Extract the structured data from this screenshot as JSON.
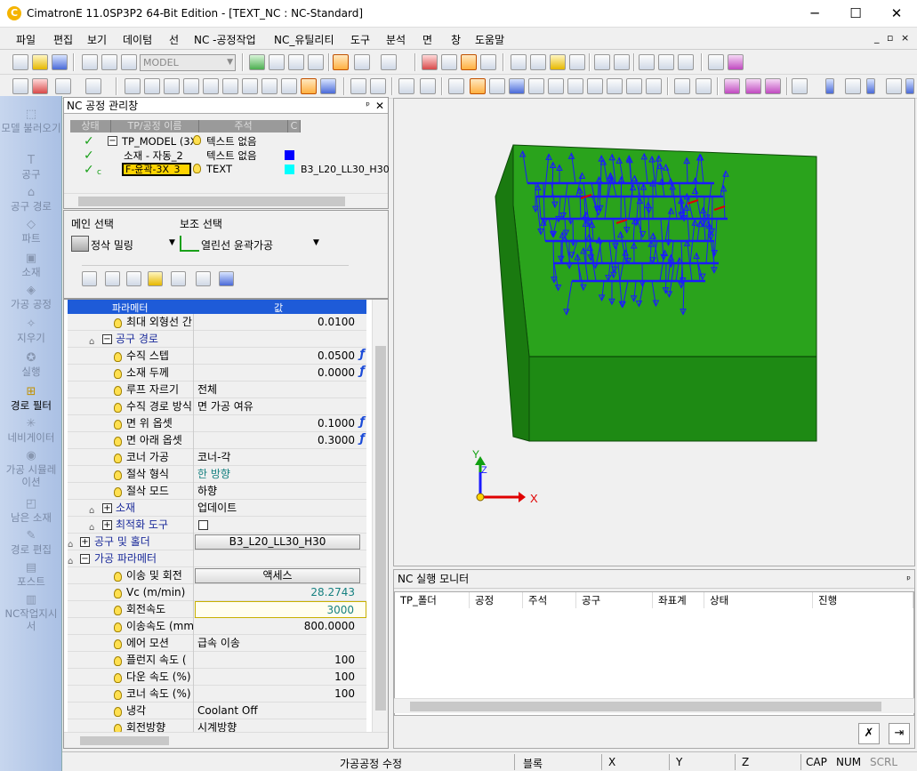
{
  "window": {
    "title": "CimatronE 11.0SP3P2 64-Bit Edition - [TEXT_NC : NC-Standard]",
    "minimize": "─",
    "maximize": "☐",
    "close": "✕"
  },
  "menu": [
    "파일",
    "편집",
    "보기",
    "데이텀",
    "선",
    "NC -공정작업",
    "NC_유틸리티",
    "도구",
    "분석",
    "면",
    "창",
    "도움말"
  ],
  "mdi_controls": [
    "_",
    "▫",
    "×"
  ],
  "toolbar": {
    "model_combo": "MODEL"
  },
  "left_strip": [
    {
      "label": "모델 불러오기",
      "icon": "model-import-icon"
    },
    {
      "label": "공구",
      "icon": "tool-icon"
    },
    {
      "label": "공구 경로",
      "icon": "toolpath-icon"
    },
    {
      "label": "파트",
      "icon": "part-icon"
    },
    {
      "label": "소재",
      "icon": "stock-icon"
    },
    {
      "label": "가공 공정",
      "icon": "procedure-icon"
    },
    {
      "label": "지우기",
      "icon": "delete-icon"
    },
    {
      "label": "실행",
      "icon": "execute-icon"
    },
    {
      "label": "경로 필터",
      "icon": "path-filter-icon"
    },
    {
      "label": "네비게이터",
      "icon": "navigator-icon"
    },
    {
      "label": "가공 시뮬레이션",
      "icon": "simulation-icon"
    },
    {
      "label": "남은 소재",
      "icon": "remaining-stock-icon"
    },
    {
      "label": "경로 편집",
      "icon": "path-edit-icon"
    },
    {
      "label": "포스트",
      "icon": "post-icon"
    },
    {
      "label": "NC작업지시서",
      "icon": "nc-worksheet-icon"
    }
  ],
  "manager": {
    "title": "NC 공정 관리창",
    "pin": "ᵖ",
    "close": "✕",
    "columns": [
      "상태",
      "TP/공정 이름",
      "주석",
      "C"
    ],
    "rows": [
      {
        "name": "TP_MODEL (3X",
        "comment": "텍스트 없음",
        "extra": ""
      },
      {
        "name": "소재 - 자동_2",
        "comment": "텍스트 없음",
        "extra": ""
      },
      {
        "status_tag": "c",
        "name": "F-윤곽-3X_3",
        "comment": "TEXT",
        "extra": "B3_L20_LL30_H30"
      }
    ]
  },
  "selection": {
    "main_label": "메인 선택",
    "sub_label": "보조 선택",
    "main_value": "정삭 밀링",
    "sub_value": "열린선 윤곽가공"
  },
  "params": {
    "col_param": "파라메터",
    "col_value": "값",
    "rows": [
      {
        "name": "최대 외형선 간",
        "value": "0.0100"
      },
      {
        "name": "공구 경로",
        "value": ""
      },
      {
        "name": "수직 스텝",
        "value": "0.0500",
        "fx": "ƒ"
      },
      {
        "name": "소재 두께",
        "value": "0.0000",
        "fx": "ƒ"
      },
      {
        "name": "루프 자르기",
        "value": "전체"
      },
      {
        "name": "수직 경로 방식",
        "value": "면 가공 여유"
      },
      {
        "name": "면 위 옵셋",
        "value": "0.1000",
        "fx": "ƒ"
      },
      {
        "name": "면 아래 옵셋",
        "value": "0.3000",
        "fx": "ƒ"
      },
      {
        "name": "코너 가공",
        "value": "코너-각"
      },
      {
        "name": "절삭 형식",
        "value": "한 방향"
      },
      {
        "name": "절삭 모드",
        "value": "하향"
      },
      {
        "name": "소재",
        "value": "업데이트"
      },
      {
        "name": "최적화 도구",
        "value": ""
      },
      {
        "name": "공구 및 홀더",
        "value": "B3_L20_LL30_H30"
      },
      {
        "name": "가공 파라메터",
        "value": ""
      },
      {
        "name": "이송 및 회전",
        "value": "액세스"
      },
      {
        "name": "Vc (m/min)",
        "value": "28.2743"
      },
      {
        "name": "회전속도",
        "value": "3000"
      },
      {
        "name": "이송속도 (mm",
        "value": "800.0000"
      },
      {
        "name": "에어 모션",
        "value": "급속 이송"
      },
      {
        "name": "플런지 속도 (",
        "value": "100"
      },
      {
        "name": "다운 속도 (%)",
        "value": "100"
      },
      {
        "name": "코너 속도 (%)",
        "value": "100"
      },
      {
        "name": "냉각",
        "value": "Coolant Off"
      },
      {
        "name": "회전방향",
        "value": "시계방향"
      }
    ]
  },
  "viewport": {
    "axis_x": "X",
    "axis_y": "Y",
    "axis_z": "Z"
  },
  "monitor": {
    "title": "NC 실행 모니터",
    "pin": "ᵖ",
    "columns": [
      "TP_폴더",
      "공정",
      "주석",
      "공구",
      "좌표계",
      "상태",
      "진행"
    ]
  },
  "status": {
    "message": "가공공정 수정",
    "block": "블록",
    "x": "X",
    "y": "Y",
    "z": "Z",
    "cap": "CAP",
    "num": "NUM",
    "scrl": "SCRL"
  },
  "colors": {
    "accent": "#1e5bd8",
    "stock_green": "#1e8a14",
    "toolpath_blue": "#1a1aff"
  }
}
